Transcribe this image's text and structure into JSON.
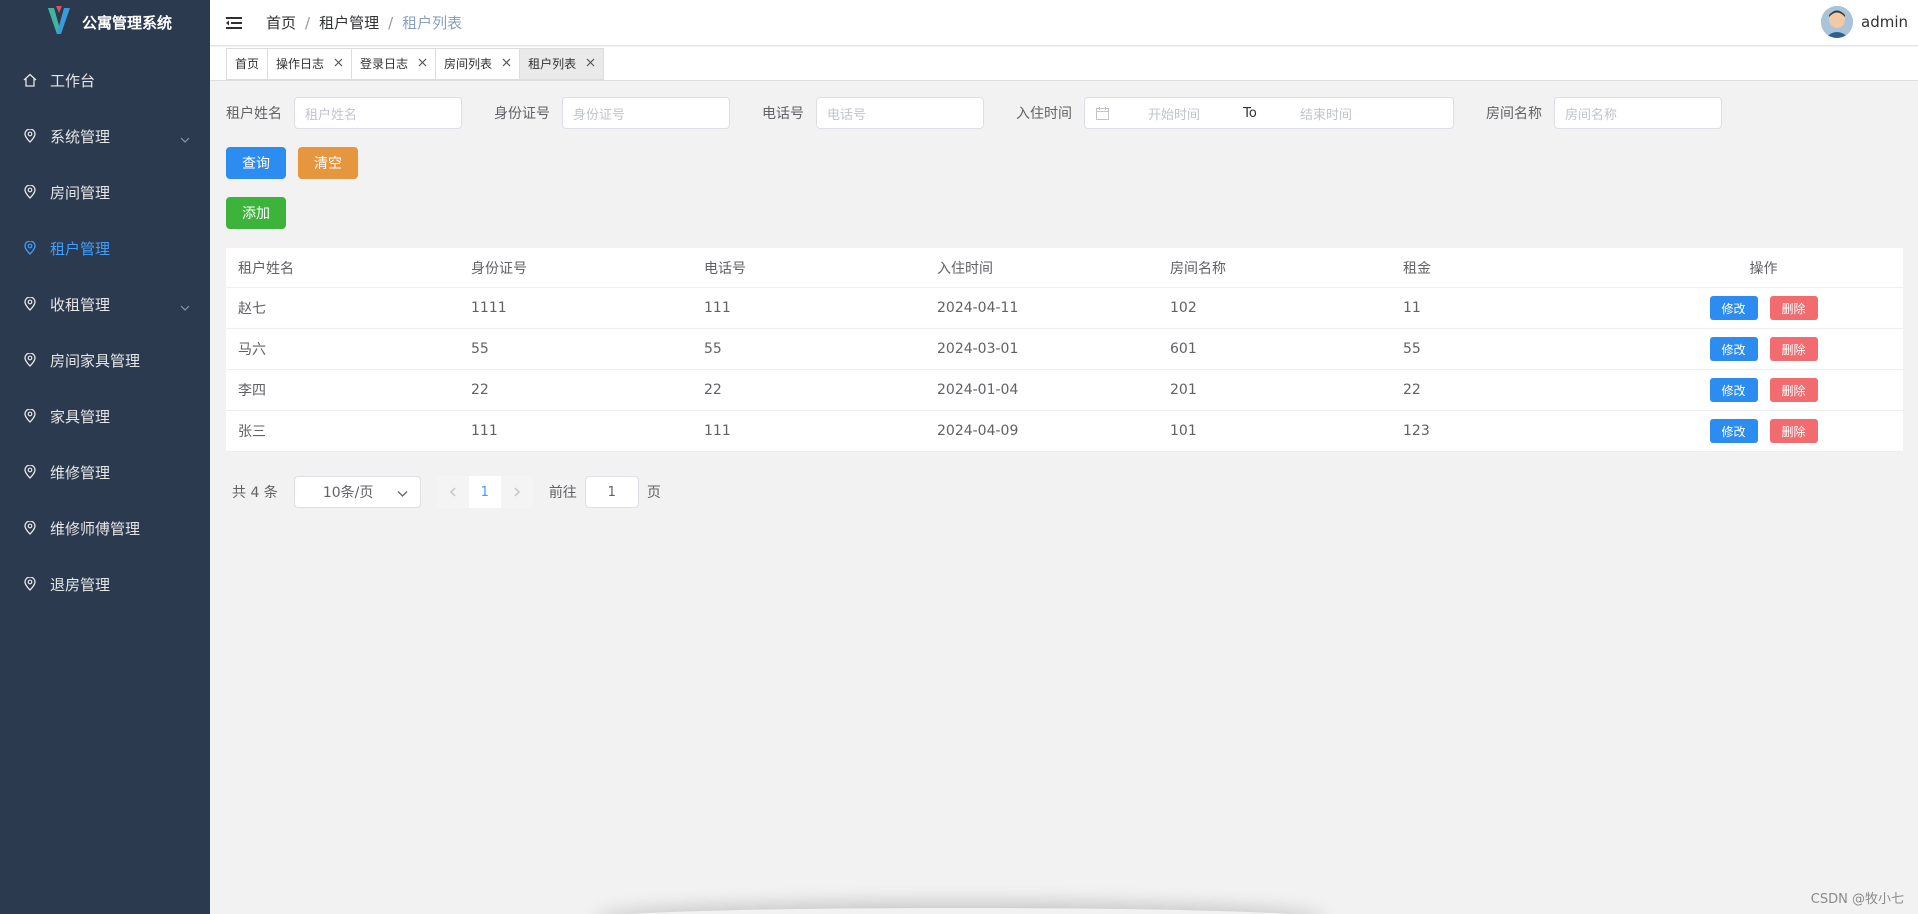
{
  "app": {
    "title": "公寓管理系统"
  },
  "sidebar": {
    "items": [
      {
        "label": "工作台",
        "icon": "home-icon"
      },
      {
        "label": "系统管理",
        "icon": "location-icon",
        "expandable": true
      },
      {
        "label": "房间管理",
        "icon": "location-icon"
      },
      {
        "label": "租户管理",
        "icon": "location-icon",
        "active": true
      },
      {
        "label": "收租管理",
        "icon": "location-icon",
        "expandable": true
      },
      {
        "label": "房间家具管理",
        "icon": "location-icon"
      },
      {
        "label": "家具管理",
        "icon": "location-icon"
      },
      {
        "label": "维修管理",
        "icon": "location-icon"
      },
      {
        "label": "维修师傅管理",
        "icon": "location-icon"
      },
      {
        "label": "退房管理",
        "icon": "location-icon"
      }
    ]
  },
  "header": {
    "breadcrumb": [
      "首页",
      "租户管理",
      "租户列表"
    ],
    "separator": "/",
    "user": "admin"
  },
  "tags": [
    {
      "label": "首页",
      "closable": false
    },
    {
      "label": "操作日志",
      "closable": true
    },
    {
      "label": "登录日志",
      "closable": true
    },
    {
      "label": "房间列表",
      "closable": true
    },
    {
      "label": "租户列表",
      "closable": true,
      "active": true
    }
  ],
  "filters": {
    "tenant_name": {
      "label": "租户姓名",
      "placeholder": "租户姓名"
    },
    "id_card": {
      "label": "身份证号",
      "placeholder": "身份证号"
    },
    "phone": {
      "label": "电话号",
      "placeholder": "电话号"
    },
    "checkin": {
      "label": "入住时间",
      "start_placeholder": "开始时间",
      "to": "To",
      "end_placeholder": "结束时间"
    },
    "room_name": {
      "label": "房间名称",
      "placeholder": "房间名称"
    }
  },
  "buttons": {
    "query": "查询",
    "clear": "清空",
    "add": "添加"
  },
  "table": {
    "columns": [
      "租户姓名",
      "身份证号",
      "电话号",
      "入住时间",
      "房间名称",
      "租金",
      "操作"
    ],
    "rows": [
      [
        "赵七",
        "1111",
        "111",
        "2024-04-11",
        "102",
        "11"
      ],
      [
        "马六",
        "55",
        "55",
        "2024-03-01",
        "601",
        "55"
      ],
      [
        "李四",
        "22",
        "22",
        "2024-01-04",
        "201",
        "22"
      ],
      [
        "张三",
        "111",
        "111",
        "2024-04-09",
        "101",
        "123"
      ]
    ],
    "edit_label": "修改",
    "delete_label": "删除"
  },
  "pagination": {
    "total_text": "共 4 条",
    "page_size": "10条/页",
    "current_page": "1",
    "goto_prefix": "前往",
    "goto_value": "1",
    "goto_suffix": "页"
  },
  "watermark": "CSDN @牧小七",
  "colors": {
    "primary": "#2d8cf0",
    "warning": "#e6963f",
    "success": "#3cb43c",
    "danger": "#f26b6f",
    "sidebar": "#2b3a4f"
  }
}
